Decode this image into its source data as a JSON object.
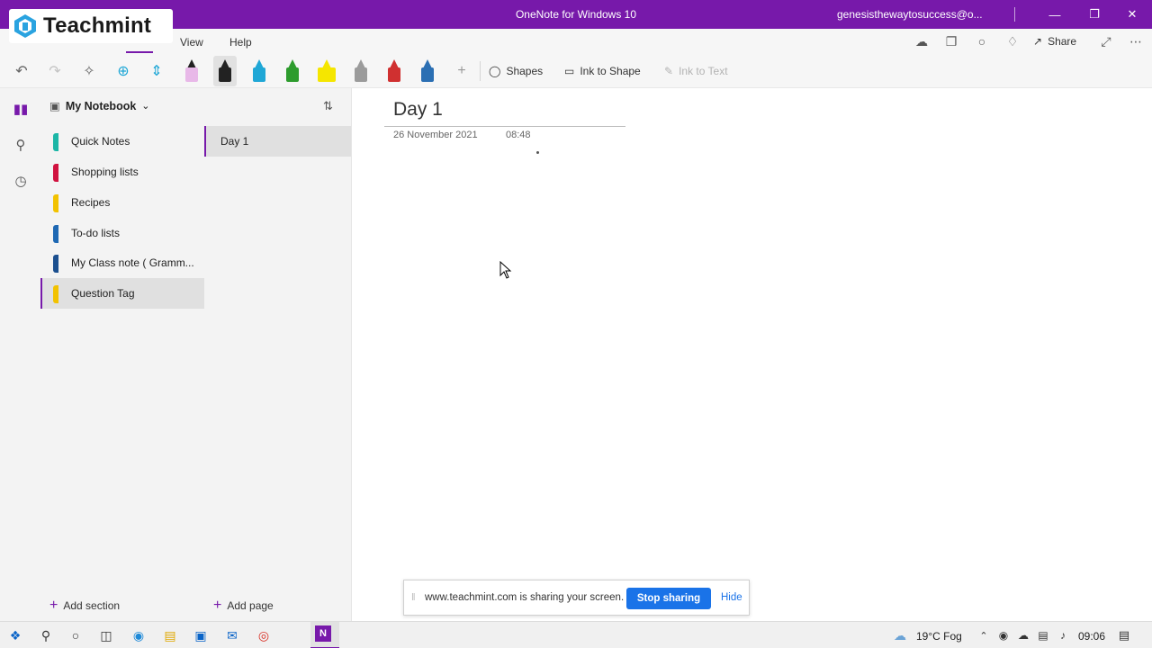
{
  "window": {
    "title": "OneNote for Windows 10",
    "account": "genesisthewaytosuccess@o...",
    "accent_color": "#7719aa"
  },
  "overlay_logo": {
    "text": "Teachmint"
  },
  "menu": {
    "items": [
      "View",
      "Help"
    ],
    "share_label": "Share"
  },
  "toolbar": {
    "shapes_label": "Shapes",
    "ink_to_shape_label": "Ink to Shape",
    "ink_to_text_label": "Ink to Text",
    "pens": [
      {
        "icon": "eraser",
        "color": "#e8b8e8"
      },
      {
        "icon": "pen",
        "color": "#222222",
        "selected": true
      },
      {
        "icon": "pen",
        "color": "#1fa7d6"
      },
      {
        "icon": "pen",
        "color": "#2e9c2e"
      },
      {
        "icon": "highlighter",
        "color": "#f5e600"
      },
      {
        "icon": "pen",
        "color": "#9b9b9b"
      },
      {
        "icon": "pen",
        "color": "#d03030"
      },
      {
        "icon": "pen",
        "color": "#2b6fb3"
      }
    ]
  },
  "notebook": {
    "name": "My Notebook",
    "sections": [
      {
        "label": "Quick Notes",
        "color": "#1bb6a6"
      },
      {
        "label": "Shopping lists",
        "color": "#d0123f"
      },
      {
        "label": "Recipes",
        "color": "#f2c200"
      },
      {
        "label": "To-do lists",
        "color": "#1e68b3"
      },
      {
        "label": "My Class note ( Gramm...",
        "color": "#1b4f8f"
      },
      {
        "label": "Question Tag",
        "color": "#f2c200",
        "active": true
      }
    ],
    "add_section_label": "Add section",
    "add_page_label": "Add page"
  },
  "pages": [
    {
      "label": "Day 1",
      "active": true
    }
  ],
  "page": {
    "title": "Day 1",
    "date": "26 November 2021",
    "time": "08:48"
  },
  "sharing_bar": {
    "message": "www.teachmint.com is sharing your screen.",
    "stop_label": "Stop sharing",
    "hide_label": "Hide"
  },
  "taskbar": {
    "weather": "19°C  Fog",
    "clock": "09:06"
  }
}
